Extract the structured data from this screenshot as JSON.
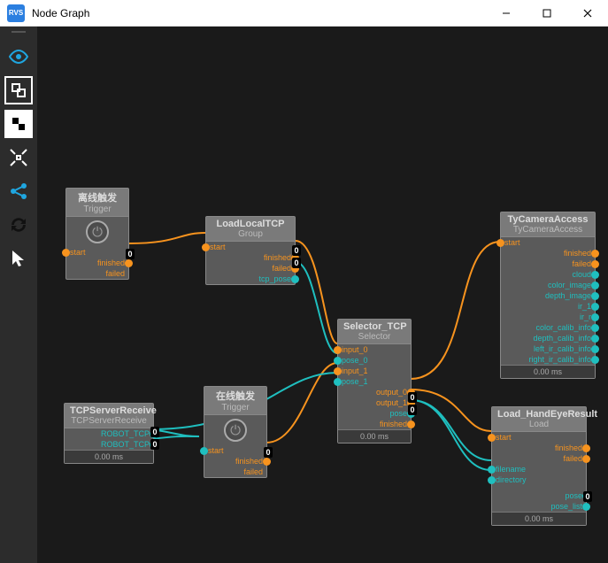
{
  "window": {
    "title": "Node Graph",
    "icon_text": "RVS"
  },
  "badge_zero": "0",
  "nodes": {
    "offline": {
      "title": "离线触发",
      "sub": "Trigger",
      "in_start": "start",
      "out_finished": "finished",
      "out_failed": "failed"
    },
    "loadlocal": {
      "title": "LoadLocalTCP",
      "sub": "Group",
      "in_start": "start",
      "out_finished": "finished",
      "out_failed": "failed",
      "out_tcp": "tcp_pose"
    },
    "tcprecv": {
      "title": "TCPServerReceive",
      "sub": "TCPServerReceive",
      "out_robot": "ROBOT_TCP",
      "out_robot2": "ROBOT_TCP",
      "footer": "0.00 ms"
    },
    "online": {
      "title": "在线触发",
      "sub": "Trigger",
      "in_start": "start",
      "out_finished": "finished",
      "out_failed": "failed"
    },
    "selector": {
      "title": "Selector_TCP",
      "sub": "Selector",
      "in0": "input_0",
      "p0": "pose_0",
      "in1": "input_1",
      "p1": "pose_1",
      "out0": "output_0",
      "out1": "output_1",
      "outp": "pose",
      "outf": "finished",
      "footer": "0.00 ms"
    },
    "cam": {
      "title": "TyCameraAccess",
      "sub": "TyCameraAccess",
      "in_start": "start",
      "o1": "finished",
      "o2": "failed",
      "o3": "cloud",
      "o4": "color_image",
      "o5": "depth_image",
      "o6": "ir_1",
      "o7": "ir_r",
      "o8": "color_calib_info",
      "o9": "depth_calib_info",
      "o10": "left_ir_calib_info",
      "o11": "right_ir_calib_info",
      "footer": "0.00 ms"
    },
    "load": {
      "title": "Load_HandEyeResult",
      "sub": "Load",
      "in_start": "start",
      "o1": "finished",
      "o2": "failed",
      "i1": "filename",
      "i2": "directory",
      "o3": "pose",
      "o4": "pose_list",
      "footer": "0.00 ms"
    }
  }
}
